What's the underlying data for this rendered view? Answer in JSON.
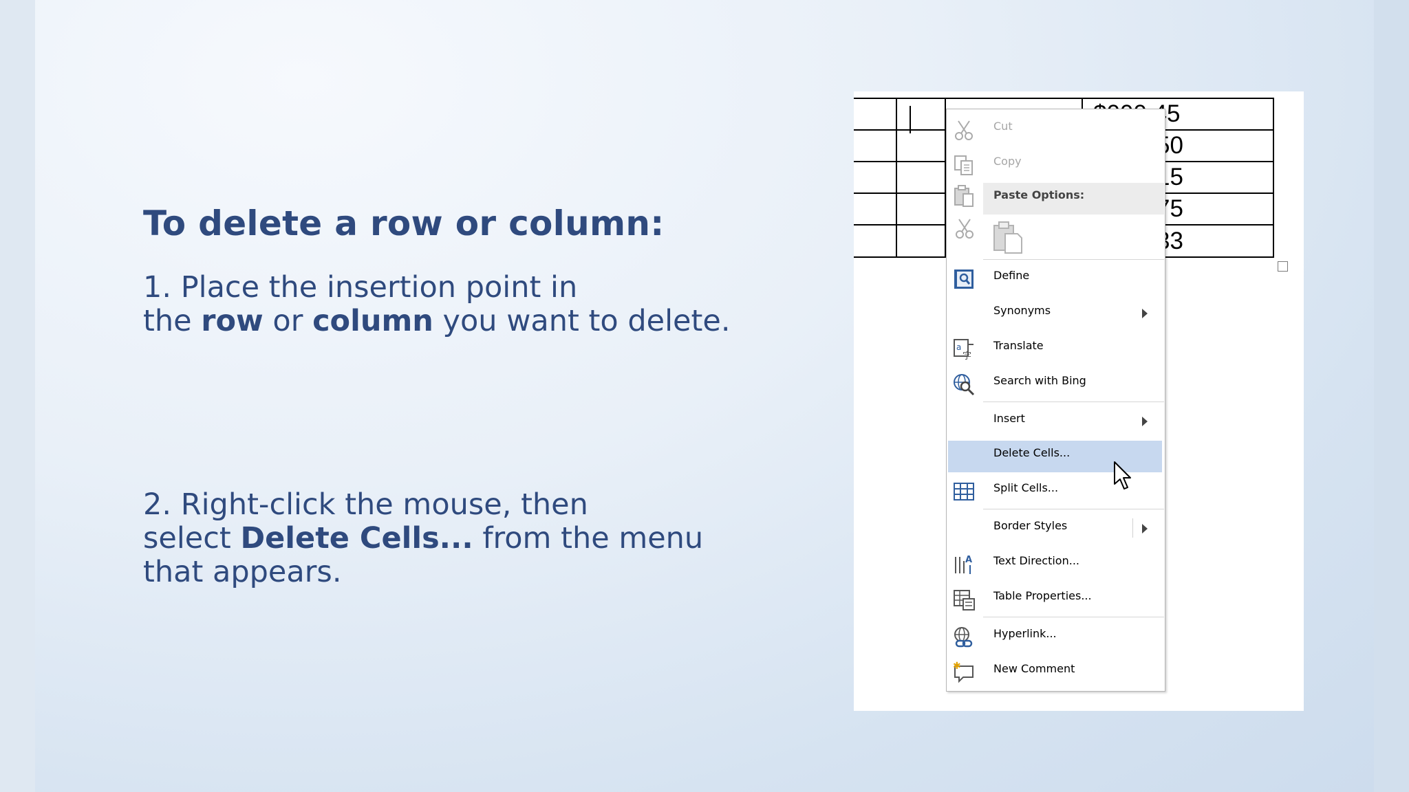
{
  "slide": {
    "heading": "To delete a row or column:",
    "step1": {
      "prefix": "1. Place the insertion point in",
      "line2_a": "the ",
      "bold1": "row",
      "mid": " or ",
      "bold2": "column",
      "suffix": " you want to delete."
    },
    "step2": {
      "line1": "2. Right-click the mouse, then",
      "line2_a": "select ",
      "bold": "Delete Cells...",
      "line2_b": " from the menu",
      "line3": "that appears."
    }
  },
  "table": {
    "cells": [
      "$000.45",
      "50",
      "15",
      "75",
      "33"
    ]
  },
  "context_menu": {
    "items": [
      {
        "label": "Cut",
        "icon": "scissors-icon",
        "enabled": false
      },
      {
        "label": "Copy",
        "icon": "copy-icon",
        "enabled": false
      },
      {
        "label": "Paste Options:",
        "icon": "paste-icon",
        "section_header": true
      },
      {
        "label": "",
        "icon": "paste-clipboard-icon"
      },
      {
        "label": "Define",
        "icon": "define-book-icon"
      },
      {
        "label": "Synonyms",
        "submenu": true
      },
      {
        "label": "Translate",
        "icon": "translate-icon"
      },
      {
        "label": "Search with Bing",
        "icon": "search-globe-icon"
      },
      {
        "label": "Insert",
        "submenu": true
      },
      {
        "label": "Delete Cells...",
        "highlighted": true
      },
      {
        "label": "Split Cells...",
        "icon": "split-cells-icon"
      },
      {
        "label": "Border Styles",
        "submenu": true
      },
      {
        "label": "Text Direction...",
        "icon": "text-direction-icon"
      },
      {
        "label": "Table Properties...",
        "icon": "table-properties-icon"
      },
      {
        "label": "Hyperlink...",
        "icon": "hyperlink-icon"
      },
      {
        "label": "New Comment",
        "icon": "new-comment-icon"
      }
    ]
  },
  "colors": {
    "text_primary": "#2f4a7e",
    "menu_highlight": "#c7d8ef",
    "menu_disabled": "#a6a6a6"
  }
}
